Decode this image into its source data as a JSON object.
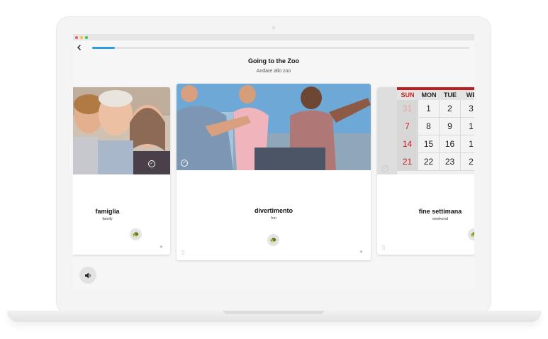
{
  "lesson": {
    "title": "Going to the Zoo",
    "subtitle": "Andare allo zoo",
    "progress": 0.06
  },
  "icons": {
    "back": "chevron-left-icon",
    "audio": "speaker-icon",
    "turtle": "turtle-icon",
    "bookmark": "bookmark-icon",
    "person": "person-icon",
    "check": "check-circle-icon"
  },
  "cards": [
    {
      "word": "famiglia",
      "translation": "family",
      "image": "family-photo"
    },
    {
      "word": "divertimento",
      "translation": "fun",
      "image": "friends-jumping-photo"
    },
    {
      "word": "fine settimana",
      "translation": "weekend",
      "image": "calendar-photo"
    }
  ],
  "calendar": {
    "headers": [
      "SUN",
      "MON",
      "TUE",
      "WE"
    ],
    "rows": [
      [
        "31",
        "1",
        "2",
        "3"
      ],
      [
        "7",
        "8",
        "9",
        "1"
      ],
      [
        "14",
        "15",
        "16",
        "1"
      ],
      [
        "21",
        "22",
        "23",
        "2"
      ]
    ]
  },
  "colors": {
    "accent": "#2b9de0",
    "calendar_red": "#c42020"
  }
}
